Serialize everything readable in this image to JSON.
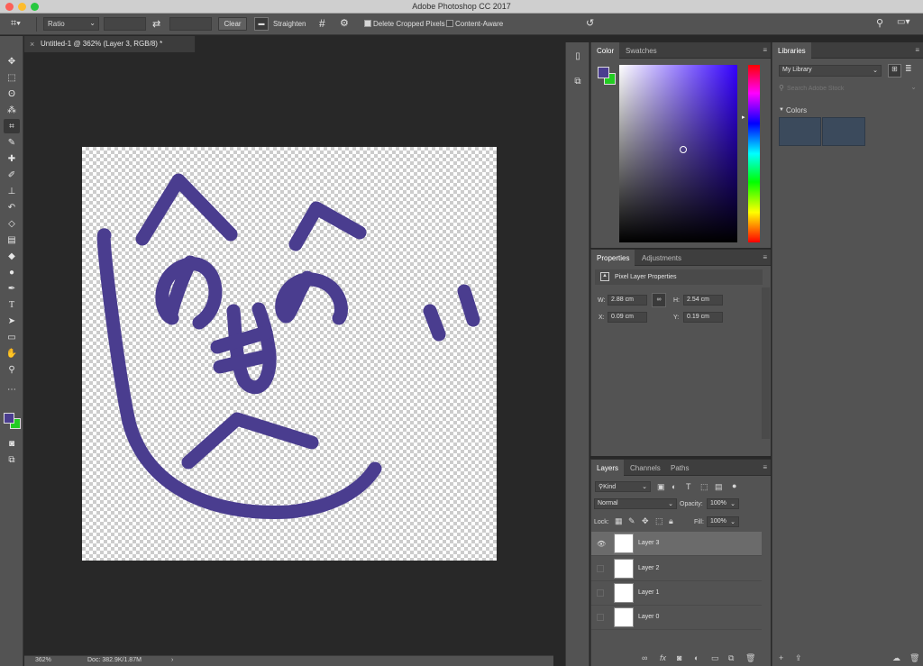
{
  "app": {
    "title": "Adobe Photoshop CC 2017"
  },
  "options": {
    "ratio": "Ratio",
    "clear": "Clear",
    "straighten": "Straighten",
    "delete_cropped": "Delete Cropped Pixels",
    "content_aware": "Content-Aware"
  },
  "document": {
    "tab": "Untitled-1 @ 362% (Layer 3, RGB/8) *",
    "zoom": "362%",
    "doc_size": "Doc: 382.9K/1.87M"
  },
  "color_panel": {
    "tabs": [
      "Color",
      "Swatches"
    ],
    "foreground": "#4a3d8f",
    "background": "#22cc22"
  },
  "properties_panel": {
    "tabs": [
      "Properties",
      "Adjustments"
    ],
    "heading": "Pixel Layer Properties",
    "w_label": "W:",
    "w": "2.88 cm",
    "h_label": "H:",
    "h": "2.54 cm",
    "x_label": "X:",
    "x": "0.09 cm",
    "y_label": "Y:",
    "y": "0.19 cm"
  },
  "layers_panel": {
    "tabs": [
      "Layers",
      "Channels",
      "Paths"
    ],
    "kind": "Kind",
    "blend": "Normal",
    "opacity_label": "Opacity:",
    "opacity": "100%",
    "lock_label": "Lock:",
    "fill_label": "Fill:",
    "fill": "100%",
    "layers": [
      "Layer 3",
      "Layer 2",
      "Layer 1",
      "Layer 0"
    ]
  },
  "libraries": {
    "tab": "Libraries",
    "library": "My Library",
    "search_placeholder": "Search Adobe Stock",
    "section": "Colors",
    "swatches": [
      "#3b4a5c",
      "#3b4a5c"
    ]
  },
  "stroke_color": "#4a3d8f"
}
